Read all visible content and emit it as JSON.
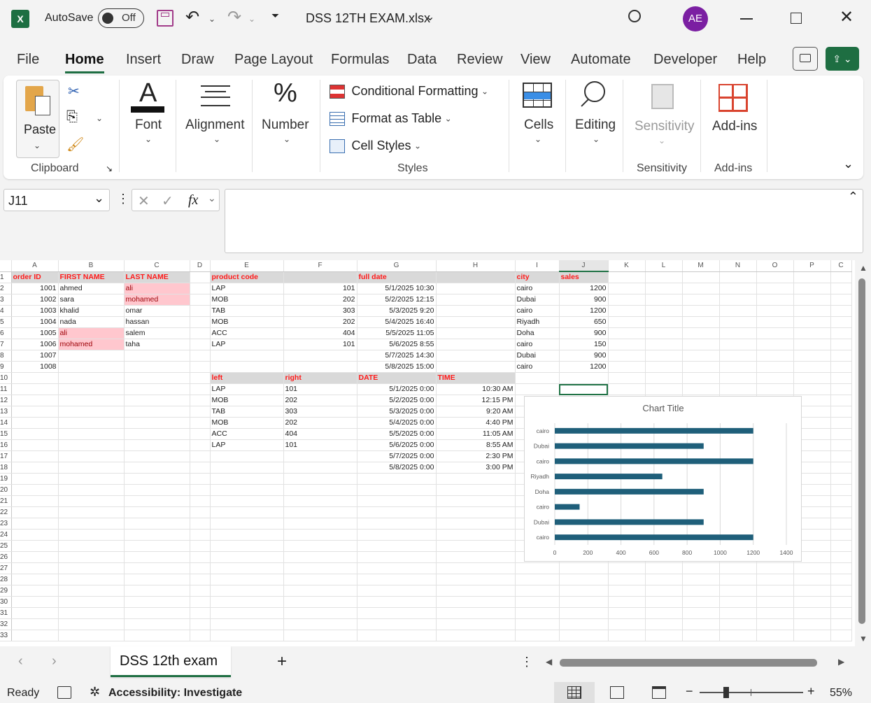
{
  "titlebar": {
    "autosave_label": "AutoSave",
    "autosave_state": "Off",
    "filename": "DSS 12TH EXAM.xlsx",
    "avatar": "AE"
  },
  "menu": [
    "File",
    "Home",
    "Insert",
    "Draw",
    "Page Layout",
    "Formulas",
    "Data",
    "Review",
    "View",
    "Automate",
    "Developer",
    "Help"
  ],
  "ribbon": {
    "paste": "Paste",
    "clipboard": "Clipboard",
    "font": "Font",
    "alignment": "Alignment",
    "number": "Number",
    "cond_format": "Conditional Formatting",
    "format_table": "Format as Table",
    "cell_styles": "Cell Styles",
    "styles": "Styles",
    "cells": "Cells",
    "editing": "Editing",
    "sensitivity": "Sensitivity",
    "sensitivity_group": "Sensitivity",
    "addins": "Add-ins",
    "addins_group": "Add-ins"
  },
  "formula_bar": {
    "name_box": "J11",
    "fx": "fx",
    "value": ""
  },
  "columns": [
    "A",
    "B",
    "C",
    "D",
    "E",
    "F",
    "G",
    "H",
    "I",
    "J",
    "K",
    "L",
    "M",
    "N",
    "O",
    "P",
    "C"
  ],
  "rows": [
    [
      "order ID",
      "FIRST NAME",
      "LAST NAME",
      "",
      "product code",
      "",
      "full date",
      "",
      "city",
      "sales",
      "",
      "",
      "",
      "",
      "",
      "",
      ""
    ],
    [
      "1001",
      "ahmed",
      "ali",
      "",
      "LAP",
      "101",
      "5/1/2025 10:30",
      "",
      "cairo",
      "1200",
      "",
      "",
      "",
      "",
      "",
      "",
      ""
    ],
    [
      "1002",
      "sara",
      "mohamed",
      "",
      "MOB",
      "202",
      "5/2/2025 12:15",
      "",
      "Dubai",
      "900",
      "",
      "",
      "",
      "",
      "",
      "",
      ""
    ],
    [
      "1003",
      "khalid",
      "omar",
      "",
      "TAB",
      "303",
      "5/3/2025 9:20",
      "",
      "cairo",
      "1200",
      "",
      "",
      "",
      "",
      "",
      "",
      ""
    ],
    [
      "1004",
      "nada",
      "hassan",
      "",
      "MOB",
      "202",
      "5/4/2025 16:40",
      "",
      "Riyadh",
      "650",
      "",
      "",
      "",
      "",
      "",
      "",
      ""
    ],
    [
      "1005",
      "ali",
      "salem",
      "",
      "ACC",
      "404",
      "5/5/2025 11:05",
      "",
      "Doha",
      "900",
      "",
      "",
      "",
      "",
      "",
      "",
      ""
    ],
    [
      "1006",
      "mohamed",
      "taha",
      "",
      "LAP",
      "101",
      "5/6/2025 8:55",
      "",
      "cairo",
      "150",
      "",
      "",
      "",
      "",
      "",
      "",
      ""
    ],
    [
      "1007",
      "",
      "",
      "",
      "",
      "",
      "5/7/2025 14:30",
      "",
      "Dubai",
      "900",
      "",
      "",
      "",
      "",
      "",
      "",
      ""
    ],
    [
      "1008",
      "",
      "",
      "",
      "",
      "",
      "5/8/2025 15:00",
      "",
      "cairo",
      "1200",
      "",
      "",
      "",
      "",
      "",
      "",
      ""
    ],
    [
      "",
      "",
      "",
      "",
      "left",
      "right",
      "DATE",
      "TIME",
      "",
      "",
      "",
      "",
      "",
      "",
      "",
      "",
      ""
    ],
    [
      "",
      "",
      "",
      "",
      "LAP",
      "101",
      "5/1/2025 0:00",
      "10:30 AM",
      "",
      "",
      "",
      "",
      "",
      "",
      "",
      "",
      ""
    ],
    [
      "",
      "",
      "",
      "",
      "MOB",
      "202",
      "5/2/2025 0:00",
      "12:15 PM",
      "",
      "",
      "",
      "",
      "",
      "",
      "",
      "",
      ""
    ],
    [
      "",
      "",
      "",
      "",
      "TAB",
      "303",
      "5/3/2025 0:00",
      "9:20 AM",
      "",
      "",
      "",
      "",
      "",
      "",
      "",
      "",
      ""
    ],
    [
      "",
      "",
      "",
      "",
      "MOB",
      "202",
      "5/4/2025 0:00",
      "4:40 PM",
      "",
      "",
      "",
      "",
      "",
      "",
      "",
      "",
      ""
    ],
    [
      "",
      "",
      "",
      "",
      "ACC",
      "404",
      "5/5/2025 0:00",
      "11:05 AM",
      "",
      "",
      "",
      "",
      "",
      "",
      "",
      "",
      ""
    ],
    [
      "",
      "",
      "",
      "",
      "LAP",
      "101",
      "5/6/2025 0:00",
      "8:55 AM",
      "",
      "",
      "",
      "",
      "",
      "",
      "",
      "",
      ""
    ],
    [
      "",
      "",
      "",
      "",
      "",
      "",
      "5/7/2025 0:00",
      "2:30 PM",
      "",
      "",
      "",
      "",
      "",
      "",
      "",
      "",
      ""
    ],
    [
      "",
      "",
      "",
      "",
      "",
      "",
      "5/8/2025 0:00",
      "3:00 PM",
      "",
      "",
      "",
      "",
      "",
      "",
      "",
      "",
      ""
    ]
  ],
  "row_count": 33,
  "chart_data": {
    "type": "bar",
    "title": "Chart Title",
    "categories": [
      "cairo",
      "Dubai",
      "cairo",
      "Doha",
      "Riyadh",
      "cairo",
      "Dubai",
      "cairo"
    ],
    "values": [
      1200,
      900,
      150,
      900,
      650,
      1200,
      900,
      1200
    ],
    "xlim": [
      0,
      1400
    ],
    "xticks": [
      0,
      200,
      400,
      600,
      800,
      1000,
      1200,
      1400
    ],
    "bar_color": "#1f5f7a",
    "grid": true
  },
  "sheet_tab": "DSS 12th exam",
  "status": {
    "ready": "Ready",
    "accessibility": "Accessibility: Investigate",
    "zoom": "55%"
  }
}
